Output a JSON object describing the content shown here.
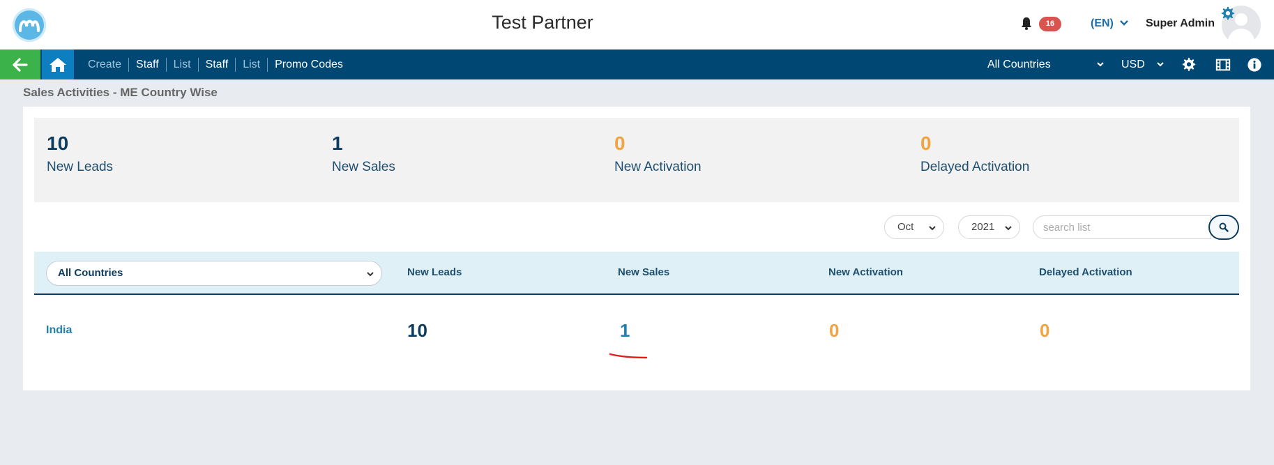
{
  "header": {
    "app_title": "Test Partner",
    "logo_icon": "brand-logo-icon",
    "notification_count": "16",
    "language": "(EN)",
    "user_name": "Super Admin"
  },
  "nav": {
    "links": [
      {
        "label": "Create",
        "style": "dim"
      },
      {
        "label": "Staff",
        "style": "bright"
      },
      {
        "label": "List",
        "style": "dim"
      },
      {
        "label": "Staff",
        "style": "bright"
      },
      {
        "label": "List",
        "style": "dim"
      },
      {
        "label": "Promo Codes",
        "style": "bright"
      }
    ],
    "country_filter": "All Countries",
    "currency": "USD",
    "icons": [
      "gear-icon",
      "film-icon",
      "info-icon"
    ]
  },
  "page": {
    "breadcrumb": "Sales Activities - ME Country Wise"
  },
  "stats": [
    {
      "value": "10",
      "label": "New Leads",
      "color": "#0d3b5e"
    },
    {
      "value": "1",
      "label": "New Sales",
      "color": "#0d3b5e"
    },
    {
      "value": "0",
      "label": "New Activation",
      "color": "#f0a442"
    },
    {
      "value": "0",
      "label": "Delayed Activation",
      "color": "#f0a442"
    }
  ],
  "filters": {
    "month": "Oct",
    "year": "2021",
    "search_placeholder": "search list"
  },
  "table": {
    "country_select": "All Countries",
    "columns": [
      "New Leads",
      "New Sales",
      "New Activation",
      "Delayed Activation"
    ],
    "rows": [
      {
        "country": "India",
        "new_leads": "10",
        "new_sales": "1",
        "new_activation": "0",
        "delayed_activation": "0"
      }
    ]
  },
  "colors": {
    "navbar": "#004773",
    "back_button": "#3cb24a",
    "home_button": "#0d7fc0",
    "accent_orange": "#f0a442",
    "navy": "#0d3b5e",
    "link_blue": "#1e7fb0"
  }
}
